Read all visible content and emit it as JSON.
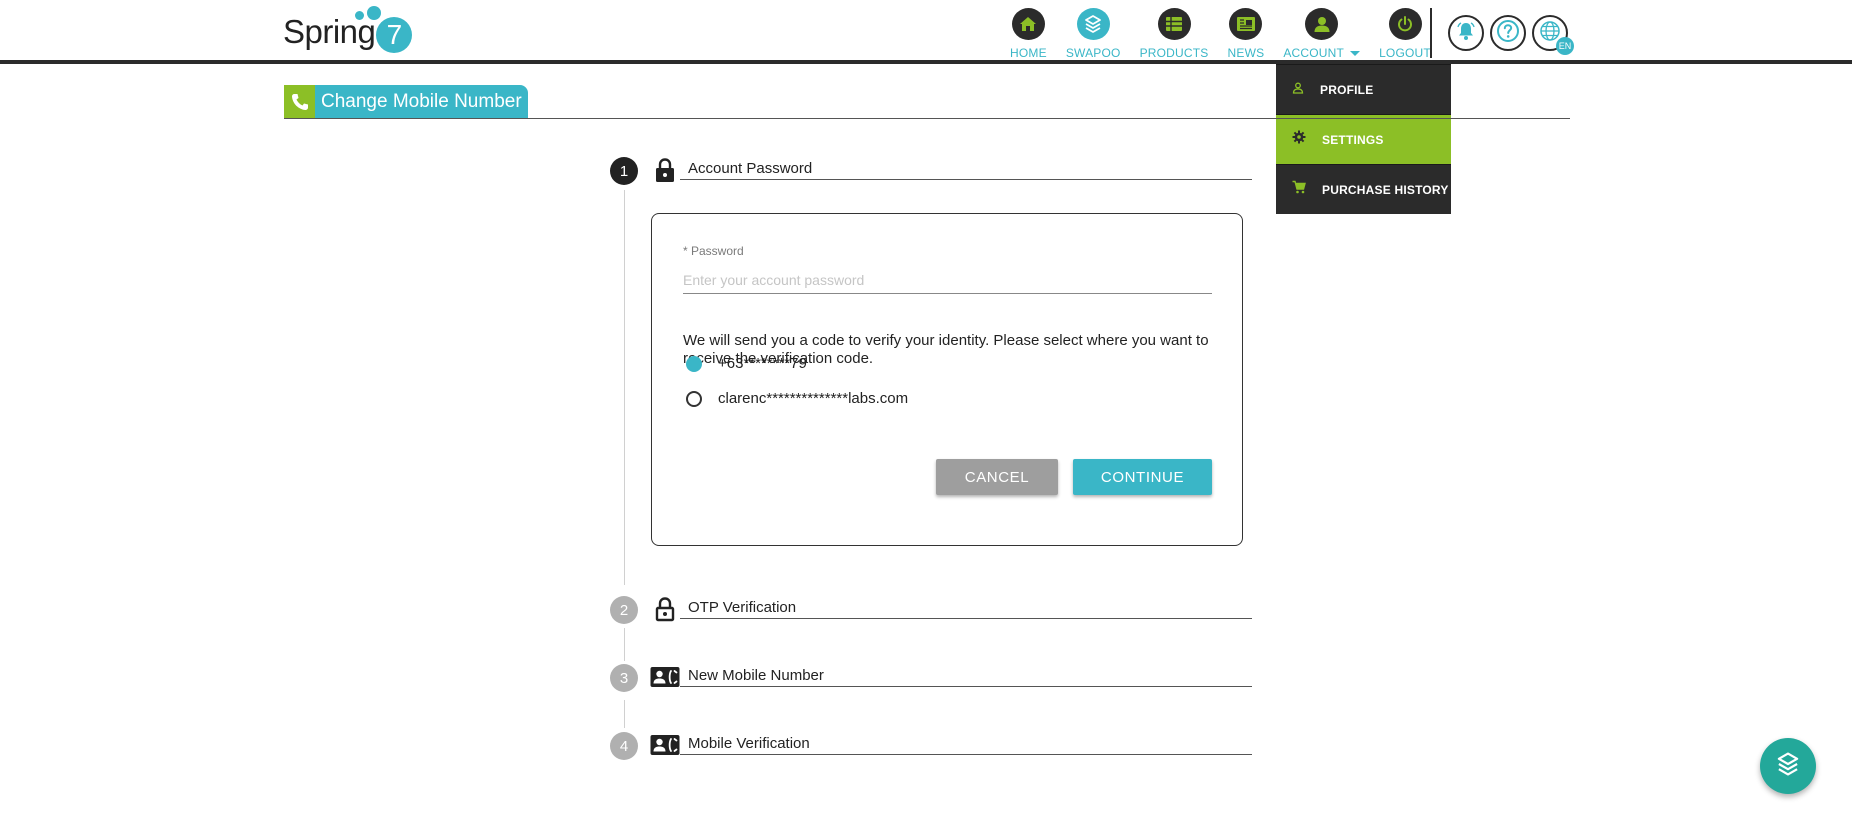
{
  "brand": {
    "logo_text": "Spring",
    "logo_number": "7"
  },
  "nav": {
    "items": [
      {
        "label": "HOME",
        "icon": "home-icon"
      },
      {
        "label": "SWAPOO",
        "icon": "swapoo-icon"
      },
      {
        "label": "PRODUCTS",
        "icon": "products-icon"
      },
      {
        "label": "NEWS",
        "icon": "news-icon"
      },
      {
        "label": "ACCOUNT",
        "icon": "account-icon"
      },
      {
        "label": "LOGOUT",
        "icon": "power-icon"
      }
    ],
    "language_badge": "EN"
  },
  "account_menu": {
    "items": [
      {
        "label": "PROFILE",
        "icon": "person-icon",
        "active": false
      },
      {
        "label": "SETTINGS",
        "icon": "gear-icon",
        "active": true
      },
      {
        "label": "PURCHASE HISTORY",
        "icon": "cart-icon",
        "active": false
      }
    ]
  },
  "page": {
    "title": "Change Mobile Number"
  },
  "steps": [
    {
      "number": "1",
      "title": "Account Password",
      "icon": "lock-icon",
      "active": true
    },
    {
      "number": "2",
      "title": "OTP Verification",
      "icon": "lock-open-icon",
      "active": false
    },
    {
      "number": "3",
      "title": "New Mobile Number",
      "icon": "contact-phone-icon",
      "active": false
    },
    {
      "number": "4",
      "title": "Mobile Verification",
      "icon": "contact-phone-icon",
      "active": false
    }
  ],
  "form": {
    "password_label": "* Password",
    "password_placeholder": "Enter your account password",
    "verify_text": "We will send you a code to verify your identity. Please select where you want to receive the verification code.",
    "options": [
      {
        "label": "+63********79",
        "selected": true
      },
      {
        "label": "clarenc**************labs.com",
        "selected": false
      }
    ],
    "cancel_label": "CANCEL",
    "continue_label": "CONTINUE"
  },
  "colors": {
    "accent": "#3ab6c7",
    "green": "#8cbf26",
    "dark": "#2b2b2b",
    "fab": "#23a89a"
  }
}
